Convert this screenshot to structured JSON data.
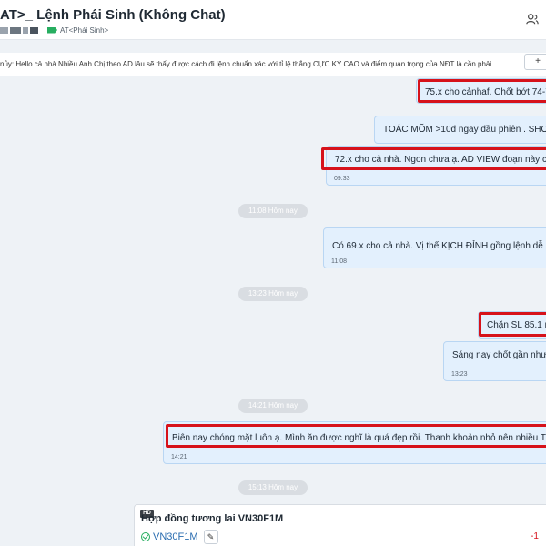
{
  "header": {
    "title": "AT>_ Lệnh Phái Sinh (Không Chat)",
    "sub_label": "AT<Phái Sinh>",
    "tag_color": "#27ae60",
    "member_icon": "people-icon"
  },
  "pinned": {
    "text": "nủy: Hello cả nhà Nhiều Anh Chị theo AD lâu sẽ thấy được cách đi lệnh chuẩn xác với tỉ lệ thắng CỰC KỲ CAO và điểm quan trọng của NĐT là cần phải ...",
    "button_label": "+"
  },
  "messages": [
    {
      "text": "75.x cho cảnhaf. Chốt bớt 74-7",
      "time": "",
      "highlighted": true
    },
    {
      "text": "TOÁC MÕM >10đ ngay đầu phiên . SHORT",
      "time": "",
      "highlighted": false
    },
    {
      "text": "72.x cho cả nhà. Ngon chưa ạ. AD VIEW đoạn này chỉ",
      "time": "09:33",
      "highlighted": true
    },
    {
      "text": "Có 69.x cho cả nhà. Vị thế KỊCH ĐỈNH gồng lệnh dễ qu",
      "time": "11:08",
      "highlighted": false
    },
    {
      "text": "Chặn SL 85.1 nh",
      "time": "",
      "highlighted": true
    },
    {
      "text": "Sáng nay chốt gần như h",
      "time": "13:23",
      "highlighted": false
    },
    {
      "text": "Biên nay chóng mặt luôn ạ. Mình ăn được nghĩ là quá đẹp rồi. Thanh khoản nhỏ nên nhiều TRAP",
      "time": "14:21",
      "highlighted": true
    }
  ],
  "date_separators": [
    "11:08 Hôm nay",
    "13:23 Hôm nay",
    "14:21 Hôm nay",
    "15:13 Hôm nay"
  ],
  "card": {
    "badge": "HD",
    "title": "Hợp đồng tương lai VN30F1M",
    "symbol": "VN30F1M",
    "edit_icon": "pencil-icon",
    "value": "-1"
  },
  "colors": {
    "bubble_bg": "#e3f0fd",
    "highlight": "#d6121b",
    "symbol": "#2a6db0"
  }
}
